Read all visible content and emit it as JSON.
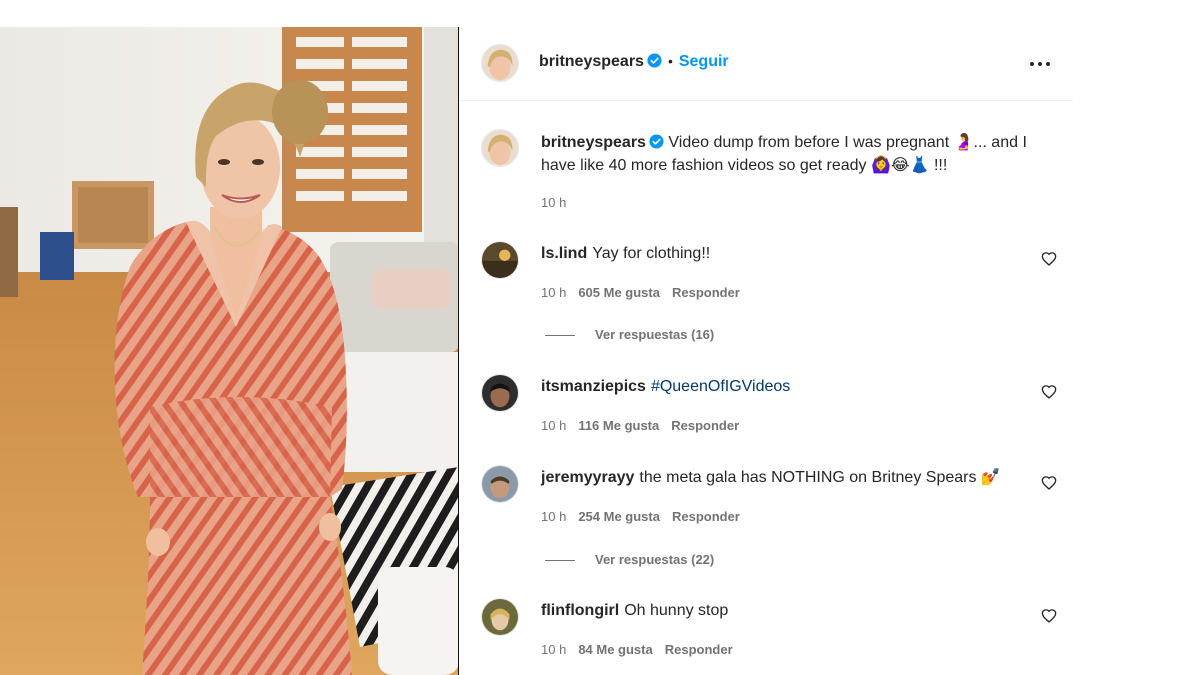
{
  "post": {
    "author": "britneyspears",
    "follow_label": "Seguir",
    "dot": "•",
    "caption_author": "britneyspears",
    "caption_text": "Video dump from before I was pregnant 🤰... and I have like 40 more fashion videos so get ready 🙆‍♀️😂👗 !!!",
    "caption_time": "10 h"
  },
  "comments": [
    {
      "username": "ls.lind",
      "text": "Yay for clothing!!",
      "time": "10 h",
      "likes": "605 Me gusta",
      "reply": "Responder",
      "view_replies": "Ver respuestas (16)"
    },
    {
      "username": "itsmanziepics",
      "text": "#QueenOfIGVideos",
      "time": "10 h",
      "likes": "116 Me gusta",
      "reply": "Responder"
    },
    {
      "username": "jeremyyrayy",
      "text": "the meta gala has NOTHING on Britney Spears 💅",
      "time": "10 h",
      "likes": "254 Me gusta",
      "reply": "Responder",
      "view_replies": "Ver respuestas (22)"
    },
    {
      "username": "flinflongirl",
      "text": "Oh hunny stop",
      "time": "10 h",
      "likes": "84 Me gusta",
      "reply": "Responder"
    }
  ],
  "icons": {
    "verified": "verified-badge-icon",
    "more": "more-options-icon",
    "heart": "heart-outline-icon"
  },
  "colors": {
    "accent": "#0095f6",
    "verified": "#0095f6",
    "secondary_text": "#737373",
    "hashtag": "#00376b"
  }
}
